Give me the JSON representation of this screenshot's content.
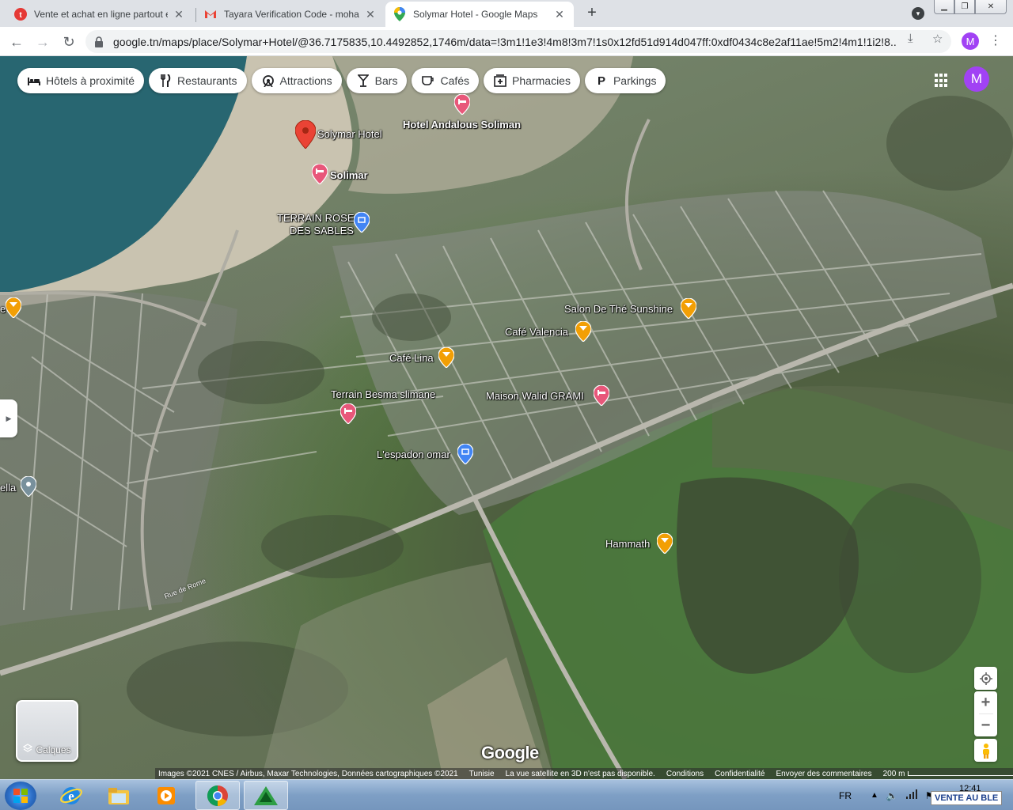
{
  "browser": {
    "tabs": [
      {
        "title": "Vente et achat en ligne partout e",
        "icon": "tayara-icon",
        "active": false
      },
      {
        "title": "Tayara Verification Code - mohan",
        "icon": "gmail-icon",
        "active": false
      },
      {
        "title": "Solymar Hotel - Google Maps",
        "icon": "google-maps-icon",
        "active": true
      }
    ],
    "url": "google.tn/maps/place/Solymar+Hotel/@36.7175835,10.4492852,1746m/data=!3m1!1e3!4m8!3m7!1s0x12fd51d914d047ff:0xdf0434c8e2af11ae!5m2!4m1!1i2!8...",
    "profile_initial": "M"
  },
  "map": {
    "chips": [
      {
        "label": "Hôtels à proximité",
        "icon": "bed-icon"
      },
      {
        "label": "Restaurants",
        "icon": "fork-knife-icon"
      },
      {
        "label": "Attractions",
        "icon": "attractions-icon"
      },
      {
        "label": "Bars",
        "icon": "cocktail-icon"
      },
      {
        "label": "Cafés",
        "icon": "coffee-cup-icon"
      },
      {
        "label": "Pharmacies",
        "icon": "pharmacy-icon"
      },
      {
        "label": "Parkings",
        "icon": "parking-icon"
      }
    ],
    "account_initial": "M",
    "places": {
      "solymar": "Solymar Hotel",
      "andalous": "Hotel Andalous Soliman",
      "solimar": "Solimar",
      "terrain_rose": "TERRAIN ROSE",
      "des_sables": "DES SABLES",
      "sunshine": "Salon De Thé Sunshine",
      "valencia": "Café Valencia",
      "lina": "Café Lina",
      "besma": "Terrain Besma slimane",
      "walid": "Maison Walid GRAMI",
      "espadon": "L'espadon omar",
      "hammath": "Hammath",
      "ella": "ella",
      "edge_e": "e",
      "road": "Rue de Rome"
    },
    "layers_label": "Calques",
    "google_logo": "Google",
    "attribution": {
      "imagery": "Images ©2021 CNES / Airbus, Maxar Technologies, Données cartographiques ©2021",
      "country": "Tunisie",
      "no3d": "La vue satellite en 3D n'est pas disponible.",
      "terms": "Conditions",
      "privacy": "Confidentialité",
      "feedback": "Envoyer des commentaires",
      "scale": "200 m"
    },
    "colors": {
      "hotel_pin": "#e8577a",
      "cafe_pin": "#f29f05",
      "attraction_pin": "#4285f4",
      "selected_pin": "#ea4335"
    }
  },
  "taskbar": {
    "language": "FR",
    "clock": "12:41",
    "notification": "VENTE AU BLE"
  }
}
